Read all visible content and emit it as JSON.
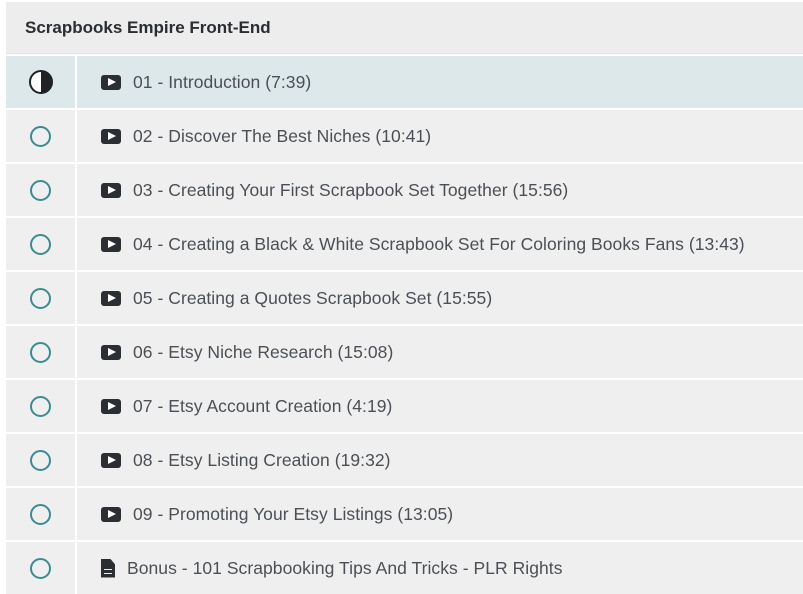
{
  "section": {
    "title": "Scrapbooks Empire Front-End"
  },
  "lessons": [
    {
      "label": "01 - Introduction (7:39)",
      "type": "video",
      "status": "in-progress"
    },
    {
      "label": "02 - Discover The Best Niches (10:41)",
      "type": "video",
      "status": "not-started"
    },
    {
      "label": "03 - Creating Your First Scrapbook Set Together (15:56)",
      "type": "video",
      "status": "not-started"
    },
    {
      "label": "04 - Creating a Black & White Scrapbook Set For Coloring Books Fans (13:43)",
      "type": "video",
      "status": "not-started"
    },
    {
      "label": "05 - Creating a Quotes Scrapbook Set (15:55)",
      "type": "video",
      "status": "not-started"
    },
    {
      "label": "06 - Etsy Niche Research (15:08)",
      "type": "video",
      "status": "not-started"
    },
    {
      "label": "07 - Etsy Account Creation (4:19)",
      "type": "video",
      "status": "not-started"
    },
    {
      "label": "08 - Etsy Listing Creation (19:32)",
      "type": "video",
      "status": "not-started"
    },
    {
      "label": "09 - Promoting Your Etsy Listings (13:05)",
      "type": "video",
      "status": "not-started"
    },
    {
      "label": "Bonus - 101 Scrapbooking Tips And Tricks - PLR Rights",
      "type": "document",
      "status": "not-started"
    }
  ],
  "colors": {
    "accent": "#3e8a91",
    "active_row": "#dce8ea",
    "row": "#efefef",
    "text": "#4b5056"
  },
  "icons": {
    "video": "play-icon",
    "document": "document-icon",
    "in-progress": "half-circle-icon",
    "not-started": "empty-circle-icon"
  }
}
